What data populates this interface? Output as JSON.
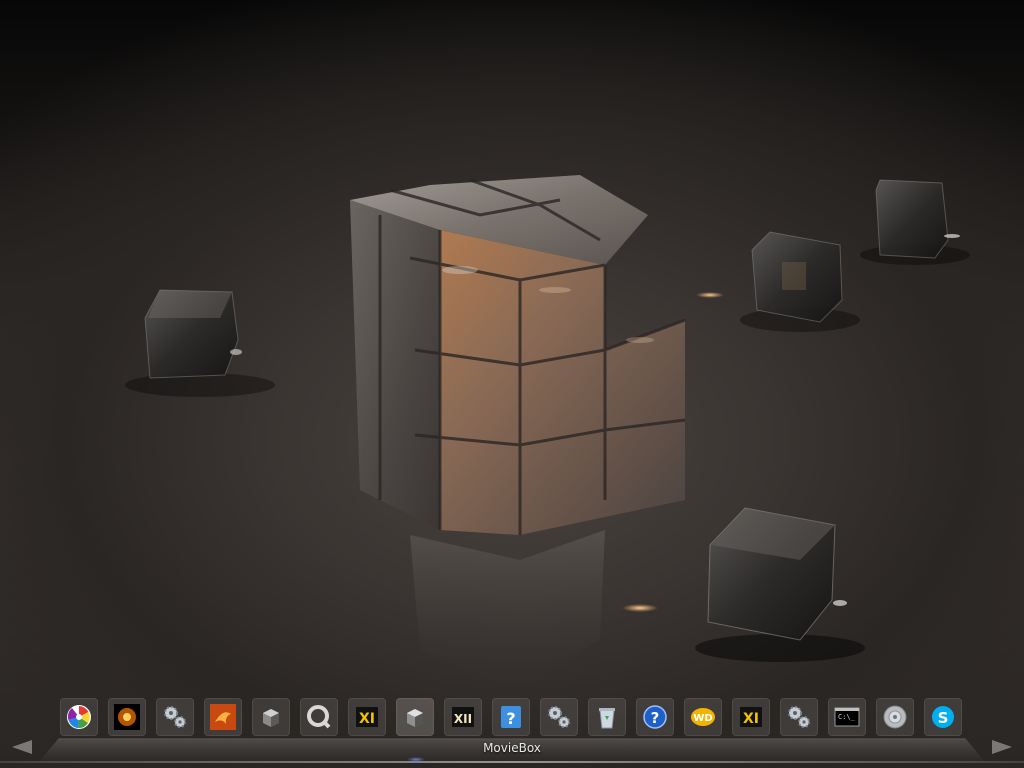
{
  "desktop": {
    "wallpaper": "metallic-cube-puzzle",
    "accent_colors": {
      "floor": "#3a3532",
      "shadow": "#0a0909",
      "copper_highlight": "#b47a4a",
      "steel": "#8c8884"
    }
  },
  "dock": {
    "tooltip": "MovieBox",
    "left_arrow": "scroll-left-icon",
    "right_arrow": "scroll-right-icon",
    "items": [
      {
        "icon": "picasa-icon"
      },
      {
        "icon": "orange-glow-icon"
      },
      {
        "icon": "gears-icon"
      },
      {
        "icon": "fire-bird-icon"
      },
      {
        "icon": "box-icon"
      },
      {
        "icon": "quicktime-icon"
      },
      {
        "icon": "xi-icon"
      },
      {
        "icon": "moviebox-icon",
        "active": true
      },
      {
        "icon": "xii-icon"
      },
      {
        "icon": "help-doc-icon"
      },
      {
        "icon": "gears-icon"
      },
      {
        "icon": "recycle-bin-icon"
      },
      {
        "icon": "help-icon"
      },
      {
        "icon": "wd-icon"
      },
      {
        "icon": "xi-icon"
      },
      {
        "icon": "gears-icon"
      },
      {
        "icon": "terminal-icon"
      },
      {
        "icon": "speaker-icon"
      },
      {
        "icon": "skype-icon"
      }
    ]
  }
}
